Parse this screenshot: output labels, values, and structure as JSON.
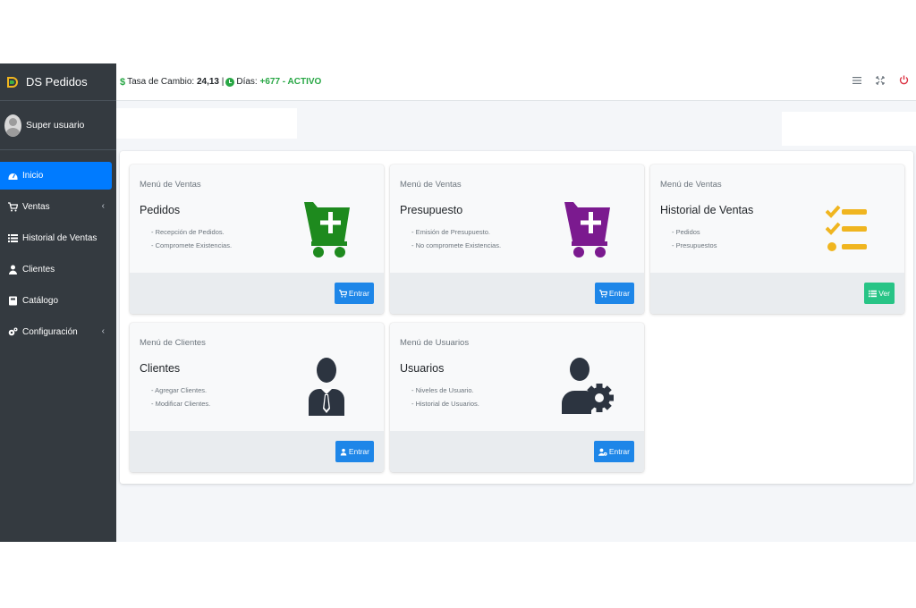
{
  "app": {
    "brand": "DS Pedidos",
    "user": "Super usuario"
  },
  "sidebar": {
    "items": [
      {
        "label": "Inicio",
        "icon": "dashboard-icon"
      },
      {
        "label": "Ventas",
        "icon": "cart-icon"
      },
      {
        "label": "Historial de Ventas",
        "icon": "list-icon"
      },
      {
        "label": "Clientes",
        "icon": "user-icon"
      },
      {
        "label": "Catálogo",
        "icon": "book-icon"
      },
      {
        "label": "Configuración",
        "icon": "gears-icon"
      }
    ]
  },
  "topbar": {
    "rate_label": "Tasa de Cambio:",
    "rate_value": "24,13",
    "separator": "|",
    "days_label": "Días:",
    "days_value": "+677 - ACTIVO",
    "icons": [
      "menu-icon",
      "fullscreen-icon",
      "power-icon"
    ]
  },
  "colors": {
    "sidebar": "#343a40",
    "primary": "#007bff",
    "success": "#28a745",
    "cart_green": "#1e8a1e",
    "cart_purple": "#7b1a8f",
    "list_yellow": "#f0b51f",
    "user_dark": "#2c3440"
  },
  "cards": [
    {
      "caption": "Menú de Ventas",
      "title": "Pedidos",
      "lines": [
        "- Recepción de Pedidos.",
        "- Compromete Existencias."
      ],
      "button": "Entrar",
      "icon": "cart-plus-icon"
    },
    {
      "caption": "Menú de Ventas",
      "title": "Presupuesto",
      "lines": [
        "- Emisión de Presupuesto.",
        "- No compromete Existencias."
      ],
      "button": "Entrar",
      "icon": "cart-plus-icon"
    },
    {
      "caption": "Menú de Ventas",
      "title": "Historial de Ventas",
      "lines": [
        "- Pedidos",
        "- Presupuestos"
      ],
      "button": "Ver",
      "icon": "tasks-icon"
    },
    {
      "caption": "Menú de Clientes",
      "title": "Clientes",
      "lines": [
        "- Agregar Clientes.",
        "- Modificar Clientes."
      ],
      "button": "Entrar",
      "icon": "user-tie-icon"
    },
    {
      "caption": "Menú de Usuarios",
      "title": "Usuarios",
      "lines": [
        "- Niveles de Usuario.",
        "- Historial de Usuarios."
      ],
      "button": "Entrar",
      "icon": "user-cog-icon"
    }
  ]
}
